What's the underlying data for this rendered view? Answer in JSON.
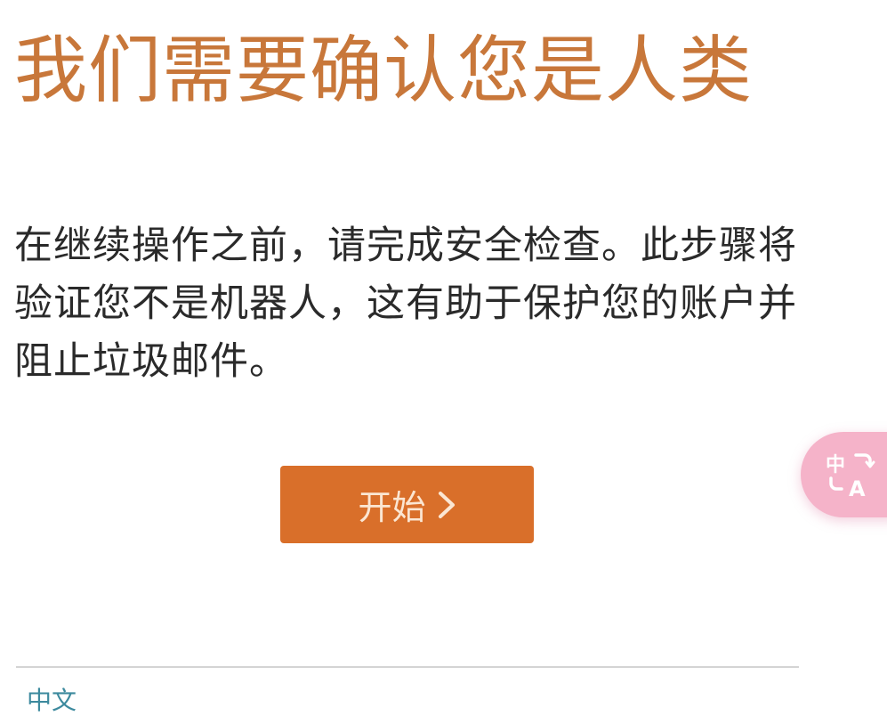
{
  "header": {
    "title": "我们需要确认您是人类"
  },
  "main": {
    "description": "在继续操作之前，请完成安全检查。此步骤将验证您不是机器人，这有助于保护您的账户并阻止垃圾邮件。",
    "start_button": {
      "label": "开始",
      "icon": "chevron-right-icon"
    }
  },
  "translate_button": {
    "icon": "translate-icon",
    "icon_text_top": "中",
    "icon_text_bottom": "A"
  },
  "footer": {
    "language_link": "中文"
  },
  "colors": {
    "title": "#c8773a",
    "button_background": "#d96f2a",
    "button_text": "#fbe6d2",
    "translate_fab": "#f5b3c9",
    "link": "#3d8a9e"
  }
}
